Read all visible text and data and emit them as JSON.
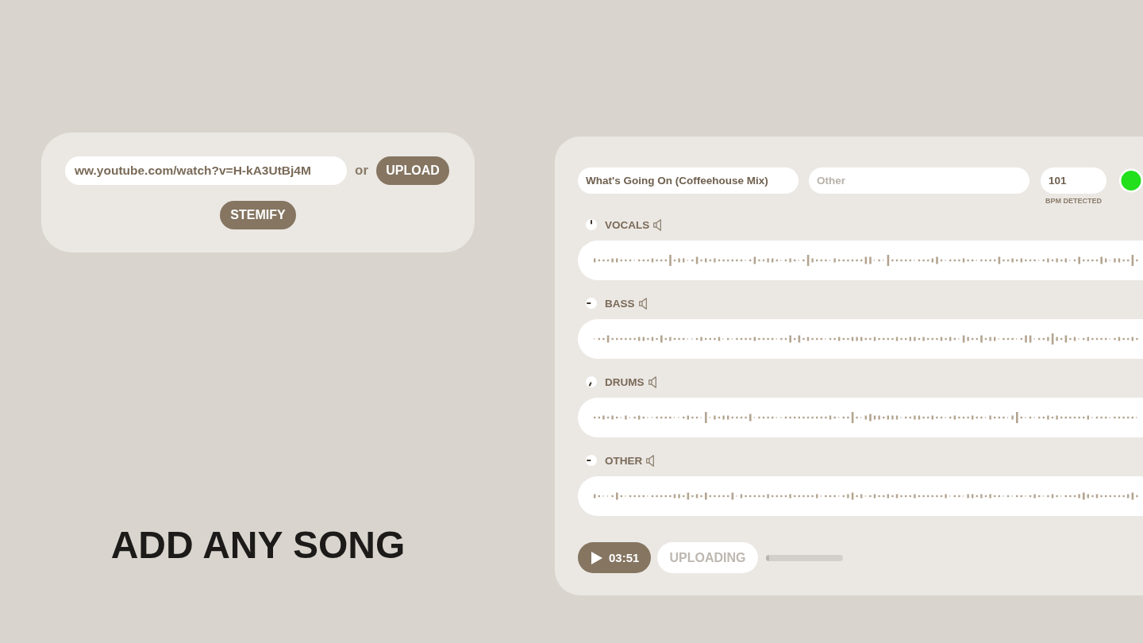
{
  "import_card": {
    "url_field": {
      "value": "ww.youtube.com/watch?v=H-kA3UtBj4M"
    },
    "separator": "or",
    "upload_button": "UPLOAD",
    "stemify_button": "STEMIFY"
  },
  "headline": "ADD ANY SONG",
  "song_panel": {
    "title_field": {
      "value": "What's Going On (Coffeehouse Mix)"
    },
    "category_field": {
      "placeholder": "Other"
    },
    "bpm_field": {
      "value": "101"
    },
    "bpm_caption": "BPM DETECTED",
    "status_dot": {
      "color": "#22e01c"
    },
    "stems": [
      {
        "name": "VOCALS"
      },
      {
        "name": "BASS"
      },
      {
        "name": "DRUMS"
      },
      {
        "name": "OTHER"
      }
    ],
    "transport": {
      "play_button": {
        "time": "03:51"
      },
      "status_pill": {
        "label": "UPLOADING",
        "disabled": true
      },
      "progress": {
        "level": 0.04
      }
    }
  }
}
